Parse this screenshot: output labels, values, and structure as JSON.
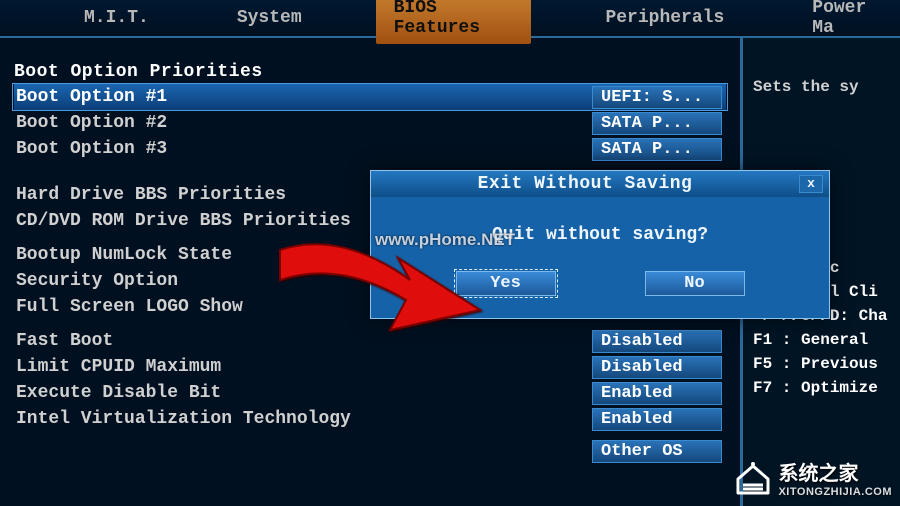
{
  "tabs": {
    "items": [
      "M.I.T.",
      "System",
      "BIOS Features",
      "Peripherals",
      "Power Ma"
    ],
    "active_index": 2
  },
  "main": {
    "section_title": "Boot Option Priorities",
    "boot_options": [
      {
        "label": "Boot Option #1",
        "value": "UEFI: S...",
        "selected": true
      },
      {
        "label": "Boot Option #2",
        "value": "SATA  P...",
        "selected": false
      },
      {
        "label": "Boot Option #3",
        "value": "SATA  P...",
        "selected": false
      }
    ],
    "drives": [
      "Hard Drive BBS Priorities",
      "CD/DVD ROM Drive BBS Priorities"
    ],
    "group1": [
      {
        "label": "Bootup NumLock State"
      },
      {
        "label": "Security Option"
      },
      {
        "label": "Full Screen LOGO Show"
      }
    ],
    "group2": [
      {
        "label": "Fast Boot",
        "value": "Disabled"
      },
      {
        "label": "Limit CPUID Maximum",
        "value": "Disabled"
      },
      {
        "label": "Execute Disable Bit",
        "value": "Enabled"
      },
      {
        "label": "Intel Virtualization Technology",
        "value": "Enabled"
      }
    ],
    "bottom_value": "Other OS"
  },
  "help": {
    "top_text": "Sets the sy",
    "items": [
      "Select Sc",
      "Enter/Dbl Cli",
      "+/-/PU/PD: Cha",
      "F1  : General",
      "F5  : Previous",
      "F7  : Optimize"
    ]
  },
  "dialog": {
    "title": "Exit Without Saving",
    "message": "Quit without saving?",
    "yes": "Yes",
    "no": "No",
    "close": "x"
  },
  "watermarks": {
    "wm1": "www.pHome.NET",
    "wm2_main": "系统之家",
    "wm2_sub": "XITONGZHIJIA.COM"
  }
}
